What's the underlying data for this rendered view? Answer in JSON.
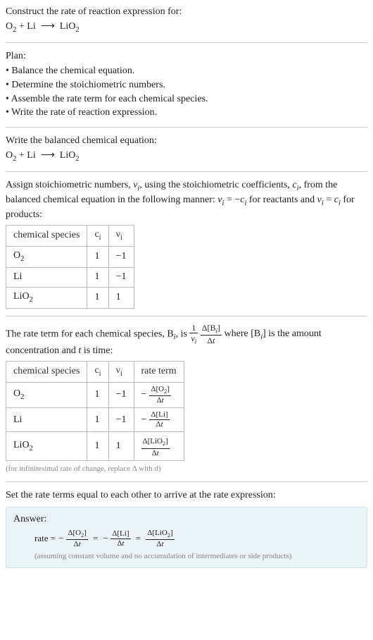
{
  "intro": {
    "prompt": "Construct the rate of reaction expression for:",
    "equation_html": "O<sub>2</sub> + Li &nbsp;&#10230;&nbsp; LiO<sub>2</sub>"
  },
  "plan": {
    "heading": "Plan:",
    "items": [
      "• Balance the chemical equation.",
      "• Determine the stoichiometric numbers.",
      "• Assemble the rate term for each chemical species.",
      "• Write the rate of reaction expression."
    ]
  },
  "balance": {
    "heading": "Write the balanced chemical equation:",
    "equation_html": "O<sub>2</sub> + Li &nbsp;&#10230;&nbsp; LiO<sub>2</sub>"
  },
  "stoich_assign": {
    "text_html": "Assign stoichiometric numbers, <i>ν<sub>i</sub></i>, using the stoichiometric coefficients, <i>c<sub>i</sub></i>, from the balanced chemical equation in the following manner: <i>ν<sub>i</sub></i> = −<i>c<sub>i</sub></i> for reactants and <i>ν<sub>i</sub></i> = <i>c<sub>i</sub></i> for products:"
  },
  "table1": {
    "headers": {
      "species": "chemical species",
      "ci": "c<sub>i</sub>",
      "vi": "ν<sub>i</sub>"
    },
    "rows": [
      {
        "species_html": "O<sub>2</sub>",
        "ci": "1",
        "vi": "−1"
      },
      {
        "species_html": "Li",
        "ci": "1",
        "vi": "−1"
      },
      {
        "species_html": "LiO<sub>2</sub>",
        "ci": "1",
        "vi": "1"
      }
    ]
  },
  "rate_term_intro": {
    "prefix": "The rate term for each chemical species, B",
    "mid": ", is ",
    "tail_html": " where [B<sub><i>i</i></sub>] is the amount concentration and <i>t</i> is time:"
  },
  "table2": {
    "headers": {
      "species": "chemical species",
      "ci": "c<sub>i</sub>",
      "vi": "ν<sub>i</sub>",
      "rate": "rate term"
    },
    "rows": [
      {
        "species_html": "O<sub>2</sub>",
        "ci": "1",
        "vi": "−1",
        "rate_num": "Δ[O<sub>2</sub>]",
        "rate_den": "Δ<i>t</i>",
        "neg": true
      },
      {
        "species_html": "Li",
        "ci": "1",
        "vi": "−1",
        "rate_num": "Δ[Li]",
        "rate_den": "Δ<i>t</i>",
        "neg": true
      },
      {
        "species_html": "LiO<sub>2</sub>",
        "ci": "1",
        "vi": "1",
        "rate_num": "Δ[LiO<sub>2</sub>]",
        "rate_den": "Δ<i>t</i>",
        "neg": false
      }
    ]
  },
  "footnote": "(for infinitesimal rate of change, replace Δ with d)",
  "final_heading": "Set the rate terms equal to each other to arrive at the rate expression:",
  "answer": {
    "label": "Answer:",
    "prefix": "rate = ",
    "terms": [
      {
        "neg": true,
        "num": "Δ[O<sub>2</sub>]",
        "den": "Δ<i>t</i>"
      },
      {
        "neg": true,
        "num": "Δ[Li]",
        "den": "Δ<i>t</i>"
      },
      {
        "neg": false,
        "num": "Δ[LiO<sub>2</sub>]",
        "den": "Δ<i>t</i>"
      }
    ],
    "note": "(assuming constant volume and no accumulation of intermediates or side products)"
  },
  "chart_data": {
    "type": "table",
    "tables": [
      {
        "title": "Stoichiometric numbers",
        "columns": [
          "chemical species",
          "c_i",
          "ν_i"
        ],
        "rows": [
          [
            "O2",
            1,
            -1
          ],
          [
            "Li",
            1,
            -1
          ],
          [
            "LiO2",
            1,
            1
          ]
        ]
      },
      {
        "title": "Rate terms",
        "columns": [
          "chemical species",
          "c_i",
          "ν_i",
          "rate term"
        ],
        "rows": [
          [
            "O2",
            1,
            -1,
            "-Δ[O2]/Δt"
          ],
          [
            "Li",
            1,
            -1,
            "-Δ[Li]/Δt"
          ],
          [
            "LiO2",
            1,
            1,
            "Δ[LiO2]/Δt"
          ]
        ]
      }
    ],
    "reaction": "O2 + Li → LiO2",
    "rate_expression": "rate = -Δ[O2]/Δt = -Δ[Li]/Δt = Δ[LiO2]/Δt"
  }
}
